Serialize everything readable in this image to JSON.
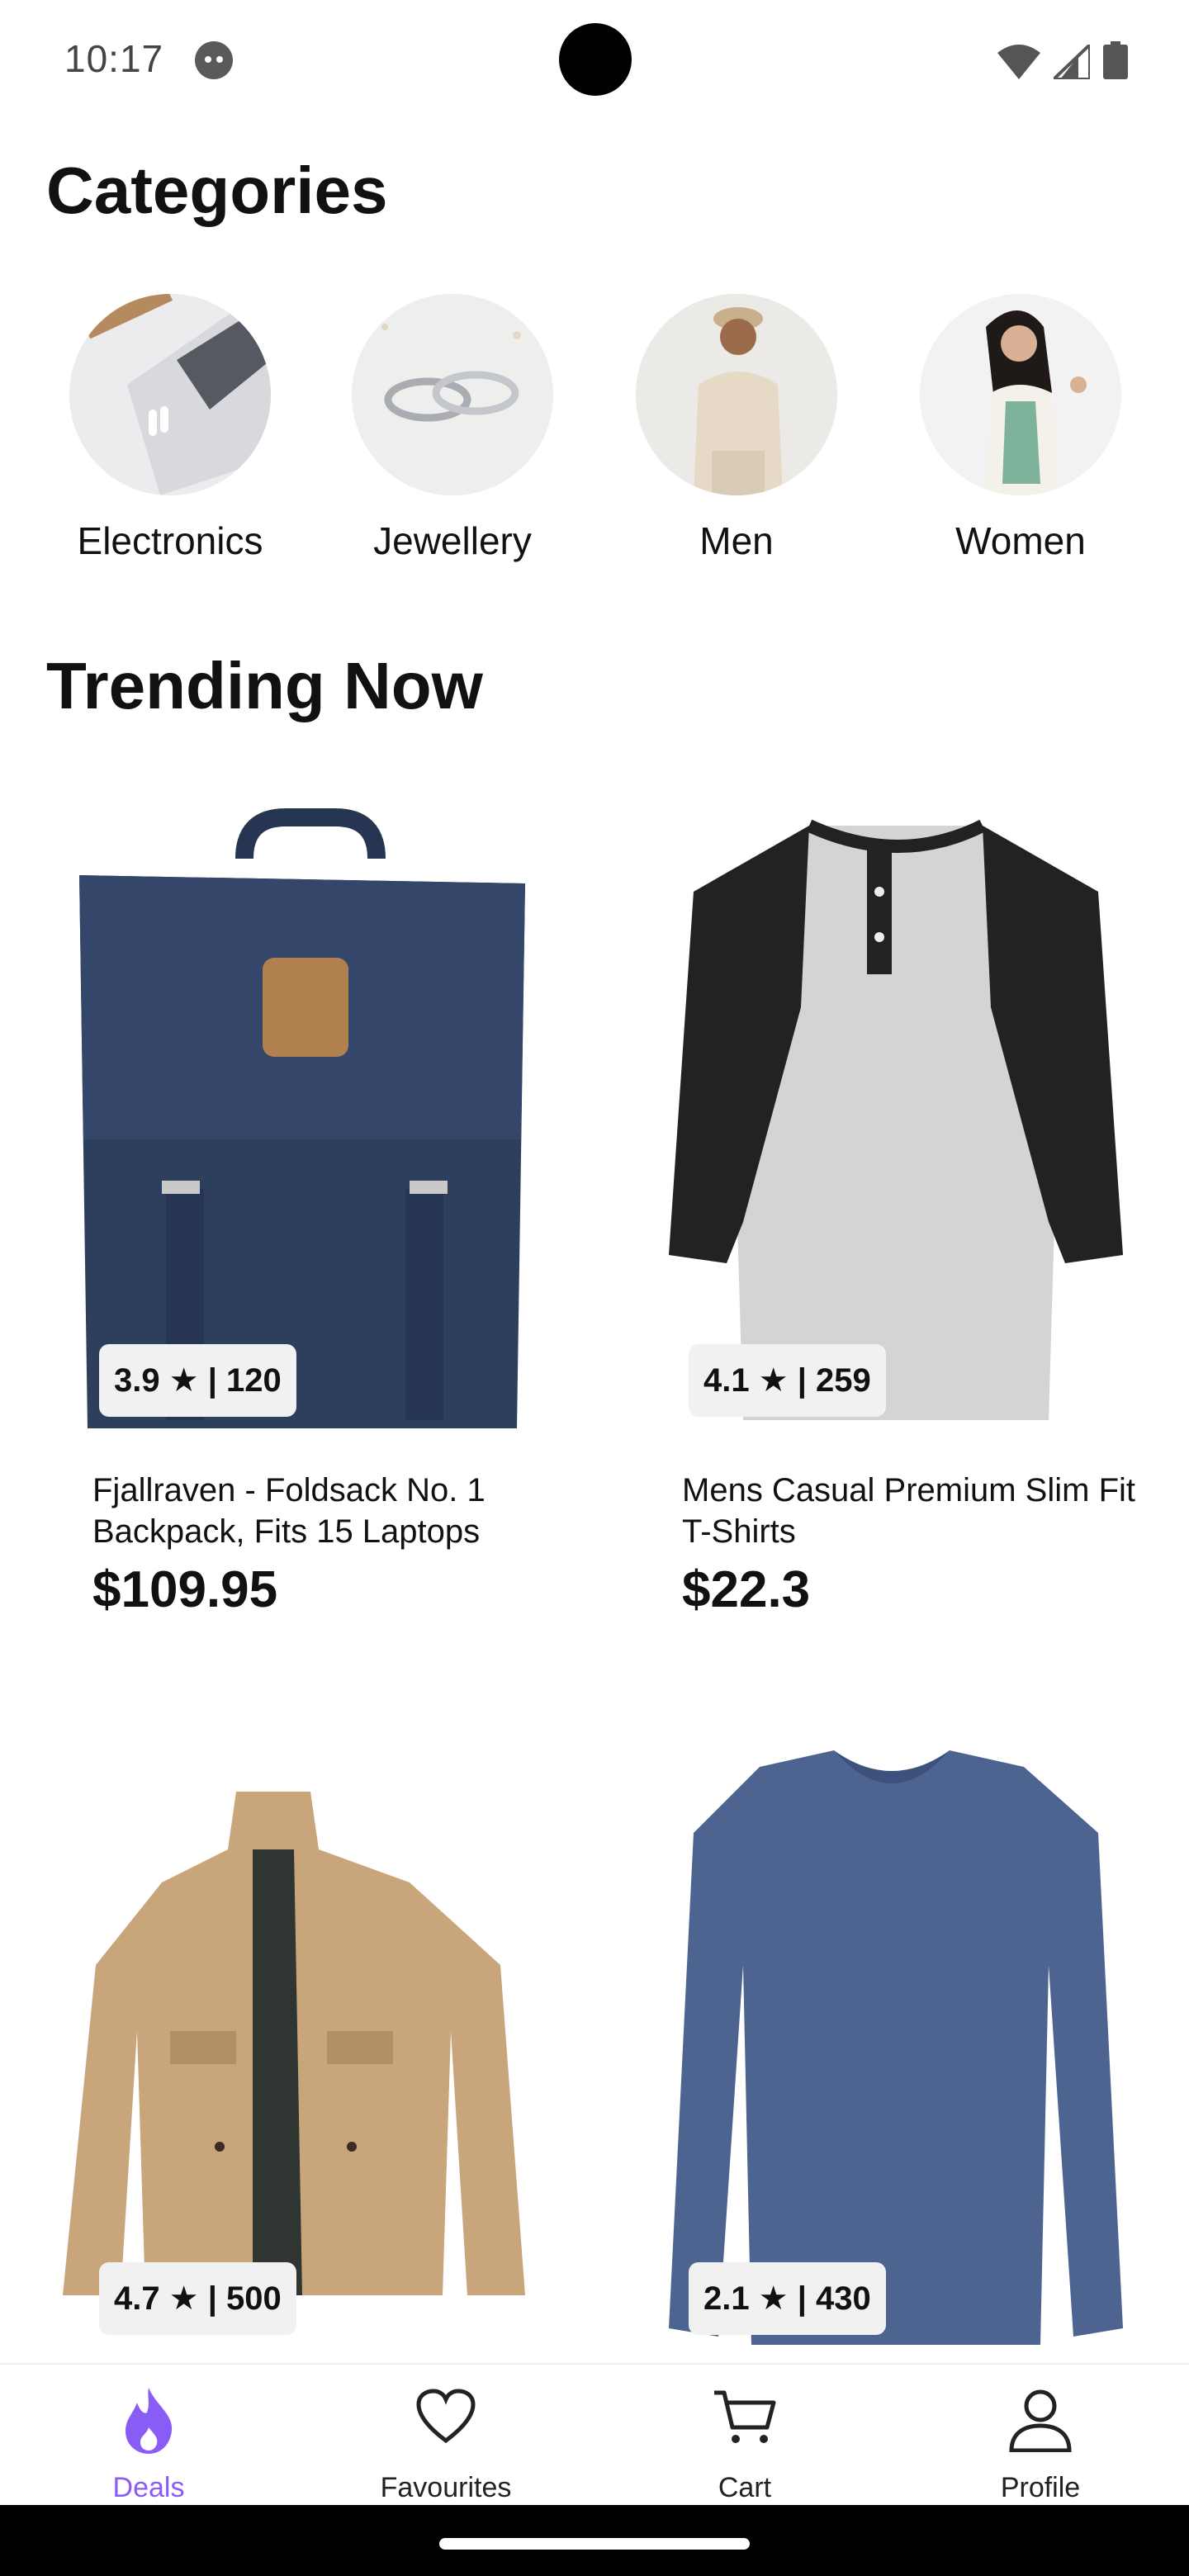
{
  "status_bar": {
    "time": "10:17"
  },
  "sections": {
    "categories_title": "Categories",
    "trending_title": "Trending Now"
  },
  "categories": [
    {
      "label": "Electronics"
    },
    {
      "label": "Jewellery"
    },
    {
      "label": "Men"
    },
    {
      "label": "Women"
    }
  ],
  "products": [
    {
      "rating": "3.9 ★ | 120",
      "name": "Fjallraven - Foldsack No. 1 Backpack, Fits 15 Laptops",
      "price": "$109.95"
    },
    {
      "rating": "4.1 ★ | 259",
      "name": "Mens Casual Premium Slim Fit T-Shirts",
      "price": "$22.3"
    },
    {
      "rating": "4.7 ★ | 500"
    },
    {
      "rating": "2.1 ★ | 430"
    }
  ],
  "bottom_nav": [
    {
      "label": "Deals",
      "active": true
    },
    {
      "label": "Favourites"
    },
    {
      "label": "Cart"
    },
    {
      "label": "Profile"
    }
  ],
  "colors": {
    "accent": "#8a5cf6",
    "backpack": "#2e3f5e",
    "jacket": "#c9a57b",
    "longsleeve": "#4d6491"
  }
}
